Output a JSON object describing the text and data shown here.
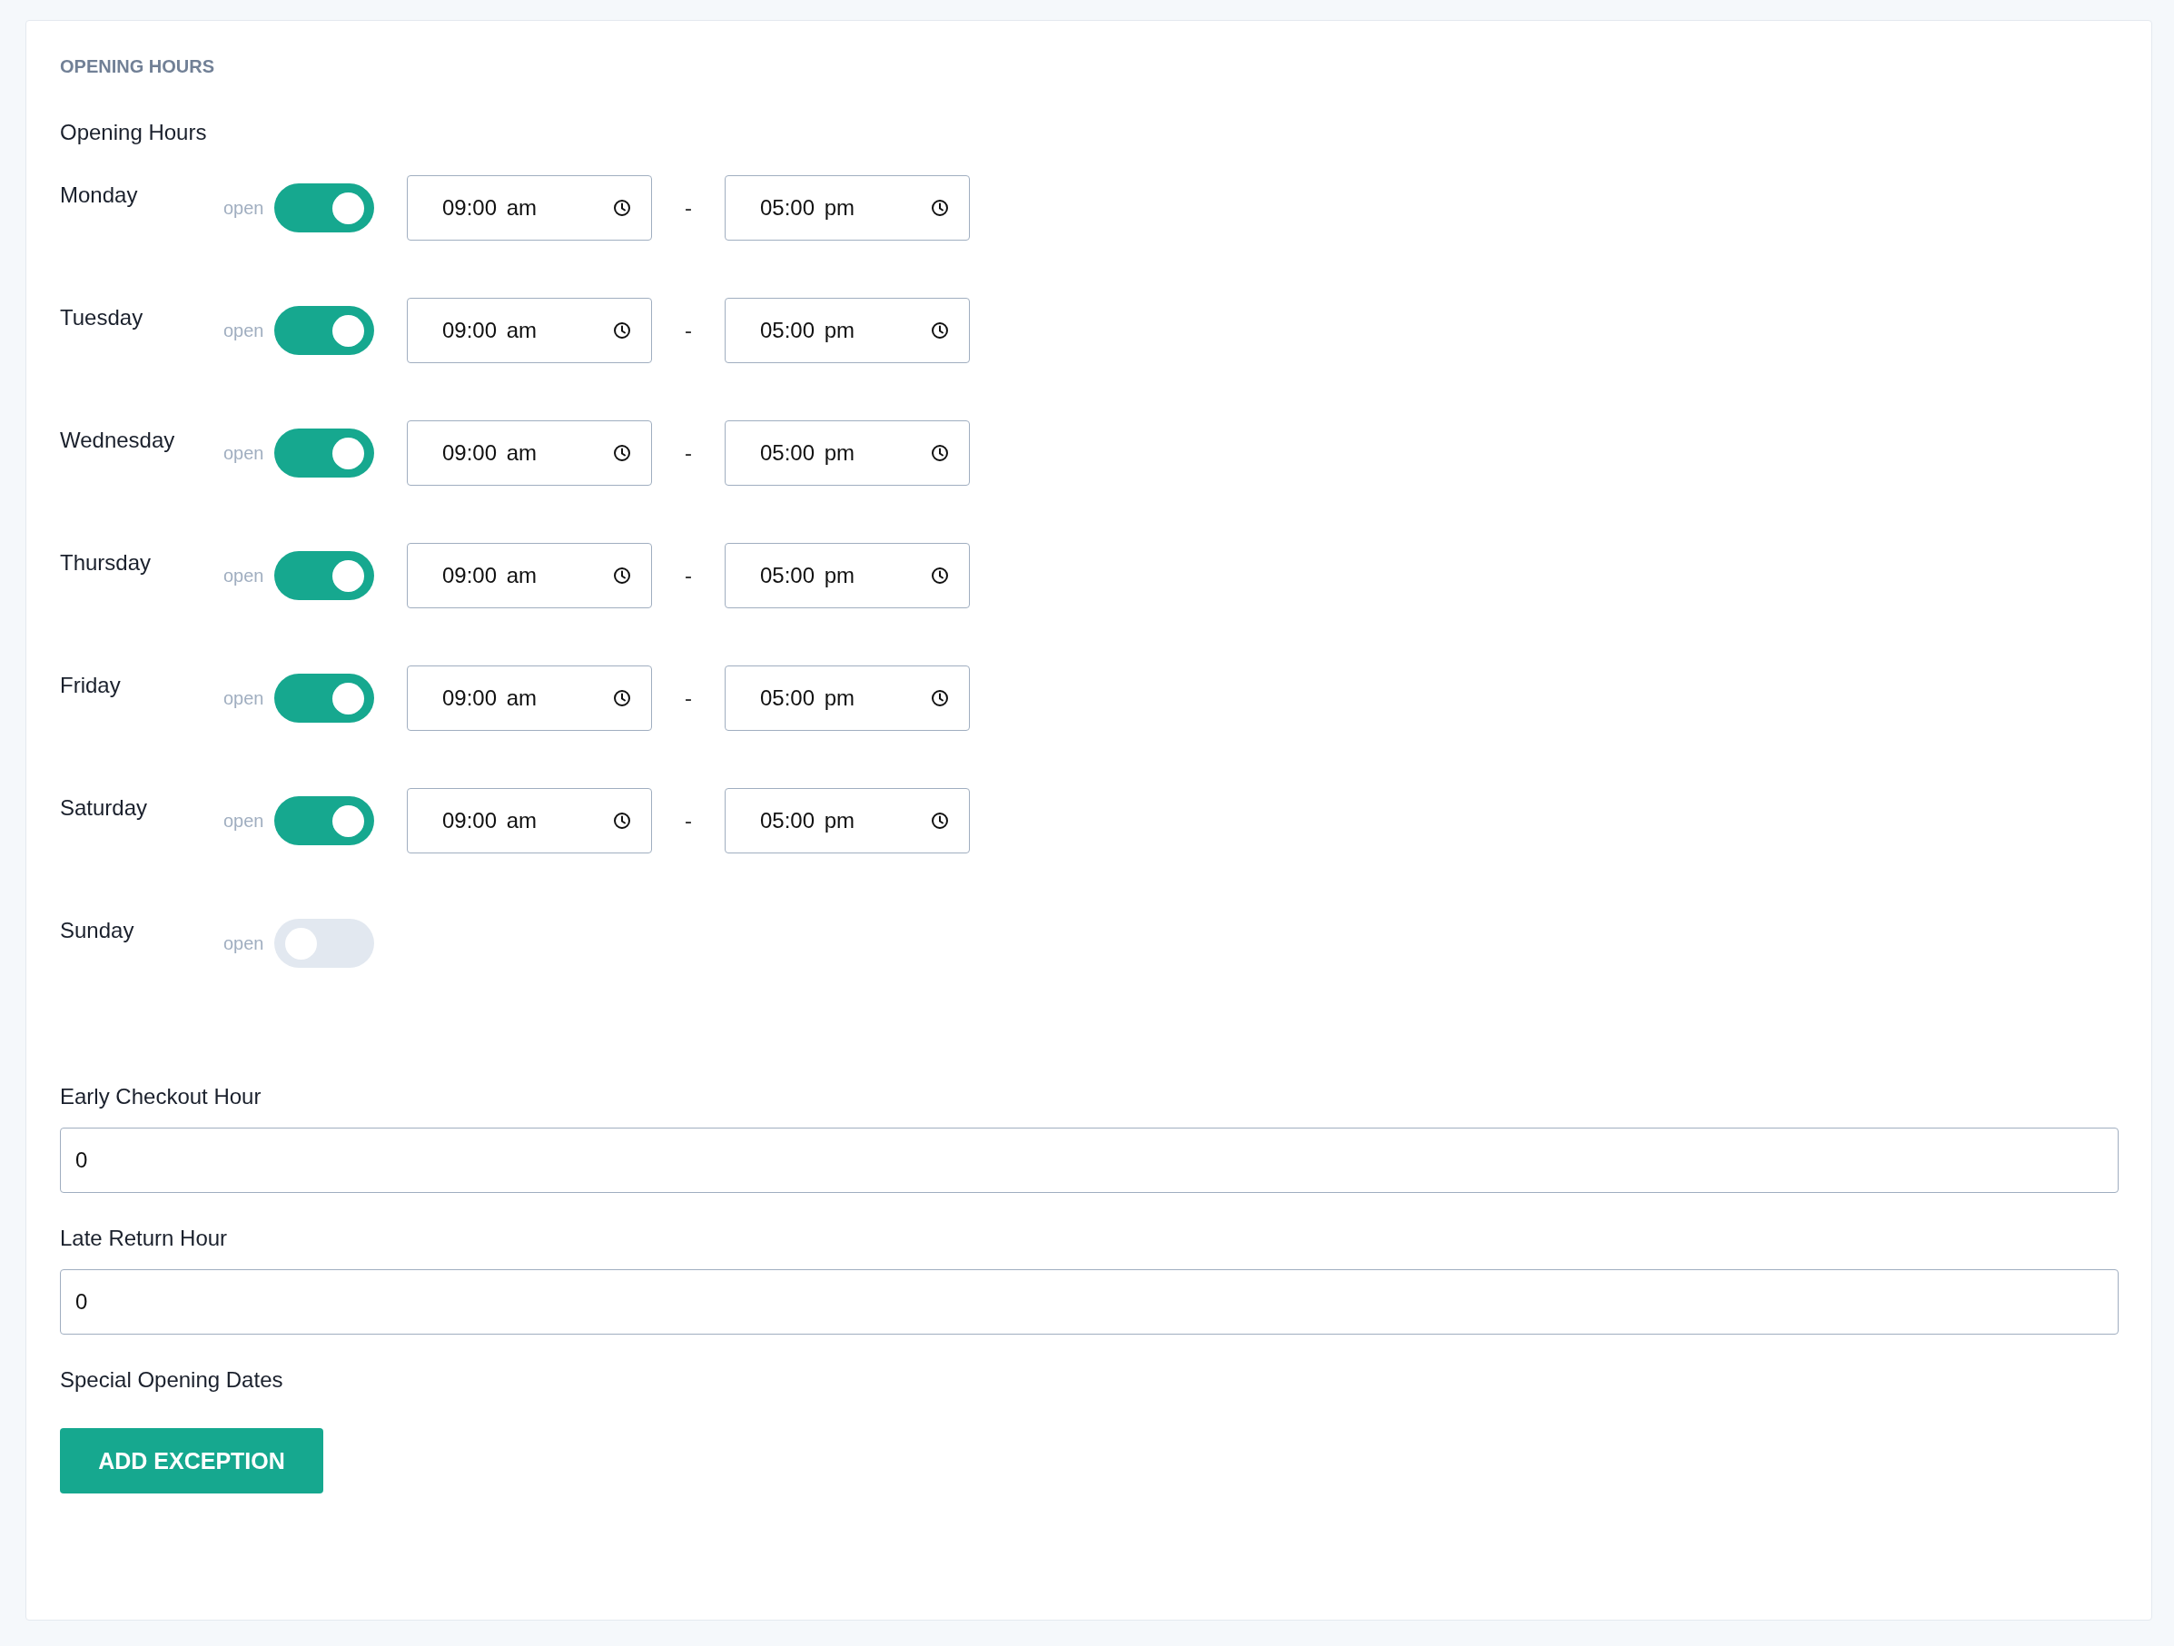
{
  "section_title": "OPENING HOURS",
  "hours_label": "Opening Hours",
  "days": [
    {
      "name": "Monday",
      "open_label": "open",
      "on": true,
      "from": "09:00 am",
      "separator": "-",
      "to": "05:00 pm"
    },
    {
      "name": "Tuesday",
      "open_label": "open",
      "on": true,
      "from": "09:00 am",
      "separator": "-",
      "to": "05:00 pm"
    },
    {
      "name": "Wednesday",
      "open_label": "open",
      "on": true,
      "from": "09:00 am",
      "separator": "-",
      "to": "05:00 pm"
    },
    {
      "name": "Thursday",
      "open_label": "open",
      "on": true,
      "from": "09:00 am",
      "separator": "-",
      "to": "05:00 pm"
    },
    {
      "name": "Friday",
      "open_label": "open",
      "on": true,
      "from": "09:00 am",
      "separator": "-",
      "to": "05:00 pm"
    },
    {
      "name": "Saturday",
      "open_label": "open",
      "on": true,
      "from": "09:00 am",
      "separator": "-",
      "to": "05:00 pm"
    },
    {
      "name": "Sunday",
      "open_label": "open",
      "on": false
    }
  ],
  "fields": [
    {
      "label": "Early Checkout Hour",
      "value": "0"
    },
    {
      "label": "Late Return Hour",
      "value": "0"
    }
  ],
  "special_label": "Special Opening Dates",
  "add_button": "ADD EXCEPTION"
}
